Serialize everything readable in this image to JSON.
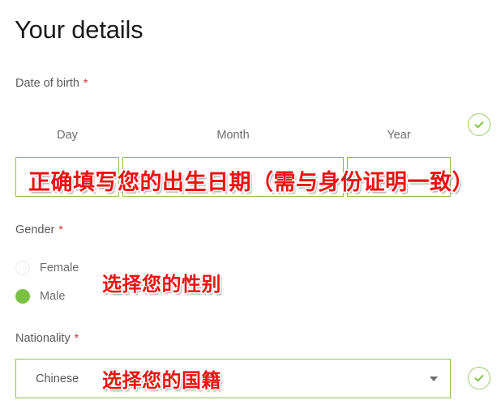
{
  "page": {
    "title": "Your details",
    "required_marker": "*"
  },
  "date_of_birth": {
    "label": "Date of birth",
    "required_marker": "*",
    "columns": [
      {
        "head": "Day",
        "value": "",
        "placeholder": ""
      },
      {
        "head": "Month",
        "value": "",
        "placeholder": ""
      },
      {
        "head": "Year",
        "value": "",
        "placeholder": ""
      }
    ],
    "status": "valid",
    "status_icon": "check-circle-icon"
  },
  "gender": {
    "label": "Gender",
    "required_marker": "*",
    "options": [
      {
        "label": "Female",
        "selected": false
      },
      {
        "label": "Male",
        "selected": true
      }
    ]
  },
  "nationality": {
    "label": "Nationality",
    "required_marker": "*",
    "selected": "Chinese",
    "arrow_icon": "chevron-down-icon",
    "status": "valid",
    "status_icon": "check-circle-icon"
  },
  "annotations": [
    {
      "id": "dob",
      "text": "正确填写您的出生日期（需与身份证明一致）"
    },
    {
      "id": "gender",
      "text": "选择您的性别"
    },
    {
      "id": "nat",
      "text": "选择您的国籍"
    }
  ],
  "colors": {
    "accent_green": "#8cc152",
    "radio_green": "#7ac143",
    "check_green": "#9ccc6a",
    "required_red": "#d0342c",
    "annotation_red": "#ee1111",
    "label_gray": "#58595b",
    "title_black": "#1a1a1a"
  }
}
